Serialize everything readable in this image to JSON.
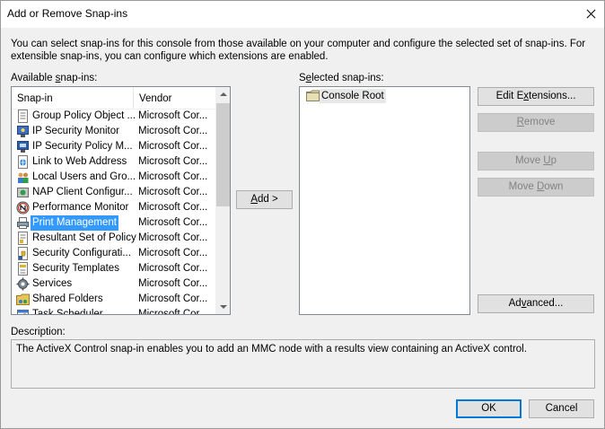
{
  "window": {
    "title": "Add or Remove Snap-ins"
  },
  "intro": "You can select snap-ins for this console from those available on your computer and configure the selected set of snap-ins. For extensible snap-ins, you can configure which extensions are enabled.",
  "available": {
    "label_pre": "Available ",
    "label_key": "s",
    "label_post": "nap-ins:",
    "col_snapin": "Snap-in",
    "col_vendor": "Vendor",
    "items": [
      {
        "name": "Group Policy Object ...",
        "vendor": "Microsoft Cor...",
        "icon": "document-icon"
      },
      {
        "name": "IP Security Monitor",
        "vendor": "Microsoft Cor...",
        "icon": "security-monitor-icon"
      },
      {
        "name": "IP Security Policy M...",
        "vendor": "Microsoft Cor...",
        "icon": "security-policy-icon"
      },
      {
        "name": "Link to Web Address",
        "vendor": "Microsoft Cor...",
        "icon": "link-icon"
      },
      {
        "name": "Local Users and Gro...",
        "vendor": "Microsoft Cor...",
        "icon": "users-icon"
      },
      {
        "name": "NAP Client Configur...",
        "vendor": "Microsoft Cor...",
        "icon": "nap-client-icon"
      },
      {
        "name": "Performance Monitor",
        "vendor": "Microsoft Cor...",
        "icon": "performance-monitor-icon"
      },
      {
        "name": "Print Management",
        "vendor": "Microsoft Cor...",
        "icon": "printer-icon",
        "selected": true
      },
      {
        "name": "Resultant Set of Policy",
        "vendor": "Microsoft Cor...",
        "icon": "policy-document-icon"
      },
      {
        "name": "Security Configurati...",
        "vendor": "Microsoft Cor...",
        "icon": "security-config-icon"
      },
      {
        "name": "Security Templates",
        "vendor": "Microsoft Cor...",
        "icon": "template-icon"
      },
      {
        "name": "Services",
        "vendor": "Microsoft Cor...",
        "icon": "gear-icon"
      },
      {
        "name": "Shared Folders",
        "vendor": "Microsoft Cor...",
        "icon": "shared-folder-icon"
      },
      {
        "name": "Task Scheduler",
        "vendor": "Microsoft Cor...",
        "icon": "task-scheduler-icon"
      }
    ]
  },
  "add_button": {
    "key": "A",
    "rest": "dd >"
  },
  "selected": {
    "label_pre": "S",
    "label_key": "e",
    "label_post": "lected snap-ins:",
    "items": [
      {
        "name": "Console Root",
        "icon": "folder-icon"
      }
    ]
  },
  "right_buttons": {
    "edit_extensions": {
      "pre": "Edit E",
      "key": "x",
      "post": "tensions..."
    },
    "remove": {
      "pre": "",
      "key": "R",
      "post": "emove"
    },
    "move_up": {
      "pre": "Move ",
      "key": "U",
      "post": "p"
    },
    "move_down": {
      "pre": "Move ",
      "key": "D",
      "post": "own"
    },
    "advanced": {
      "pre": "Ad",
      "key": "v",
      "post": "anced..."
    }
  },
  "description": {
    "label": "Description:",
    "text": "The ActiveX Control snap-in enables you to add an MMC node with a results view containing an ActiveX control."
  },
  "footer": {
    "ok_label": "OK",
    "cancel_label": "Cancel"
  },
  "colors": {
    "selection": "#3399ff",
    "default_button_border": "#0078d7"
  }
}
